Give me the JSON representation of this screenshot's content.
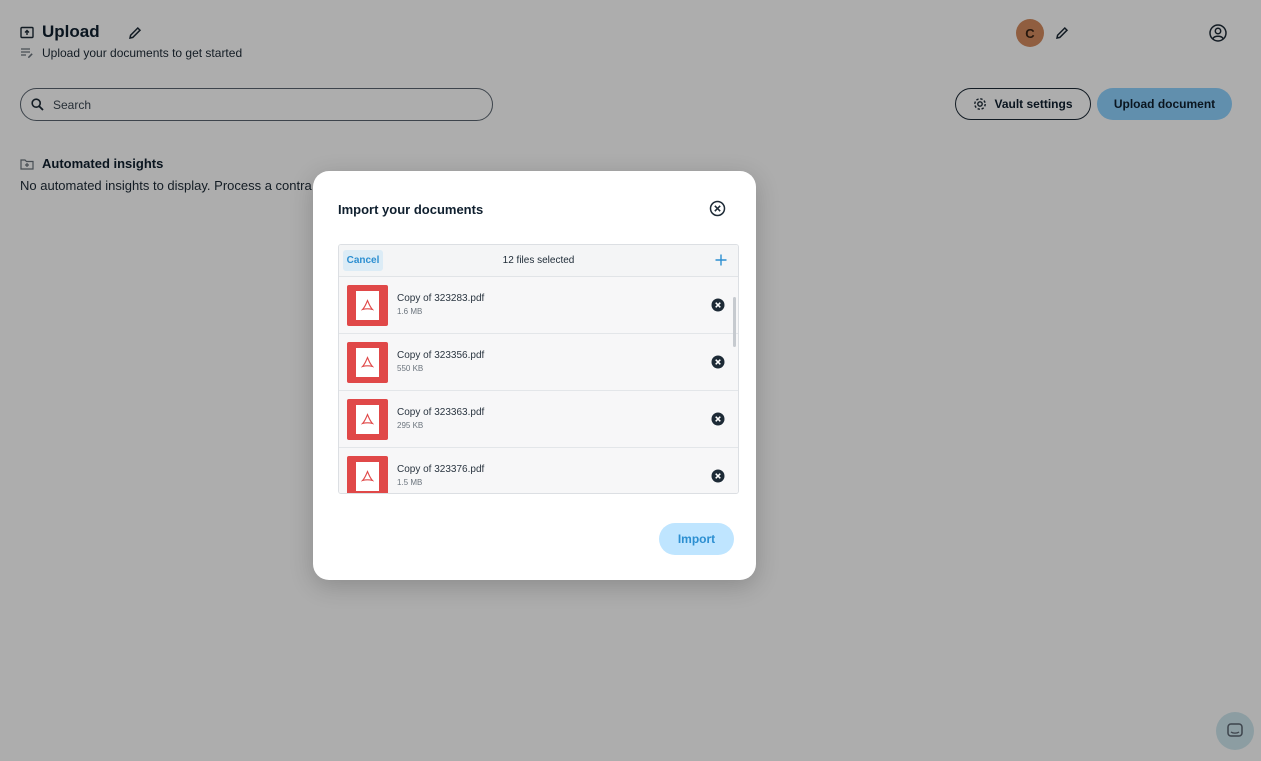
{
  "header": {
    "title": "Upload",
    "subtitle": "Upload your documents to get started",
    "avatar_initial": "C"
  },
  "search": {
    "placeholder": "Search"
  },
  "toolbar": {
    "vault_settings_label": "Vault settings",
    "upload_document_label": "Upload document"
  },
  "insights": {
    "title": "Automated insights",
    "empty_text": "No automated insights to display. Process a contra"
  },
  "modal": {
    "title": "Import your documents",
    "cancel_label": "Cancel",
    "files_selected": "12 files selected",
    "import_label": "Import",
    "files": [
      {
        "name": "Copy of 323283.pdf",
        "size": "1.6 MB"
      },
      {
        "name": "Copy of 323356.pdf",
        "size": "550 KB"
      },
      {
        "name": "Copy of 323363.pdf",
        "size": "295 KB"
      },
      {
        "name": "Copy of 323376.pdf",
        "size": "1.5 MB"
      }
    ]
  },
  "colors": {
    "accent": "#8fd3ff",
    "pdf_red": "#e04848",
    "avatar": "#d48b5f"
  },
  "icons": {
    "title_icon": "folder-upload-icon",
    "edit": "pencil-icon",
    "profile": "user-circle-icon",
    "search": "search-icon",
    "gear": "gear-icon",
    "folder": "folder-icon",
    "close": "close-circle-icon",
    "add": "plus-icon",
    "pdf": "pdf-file-icon",
    "remove": "remove-circle-icon",
    "chat": "chat-icon"
  }
}
